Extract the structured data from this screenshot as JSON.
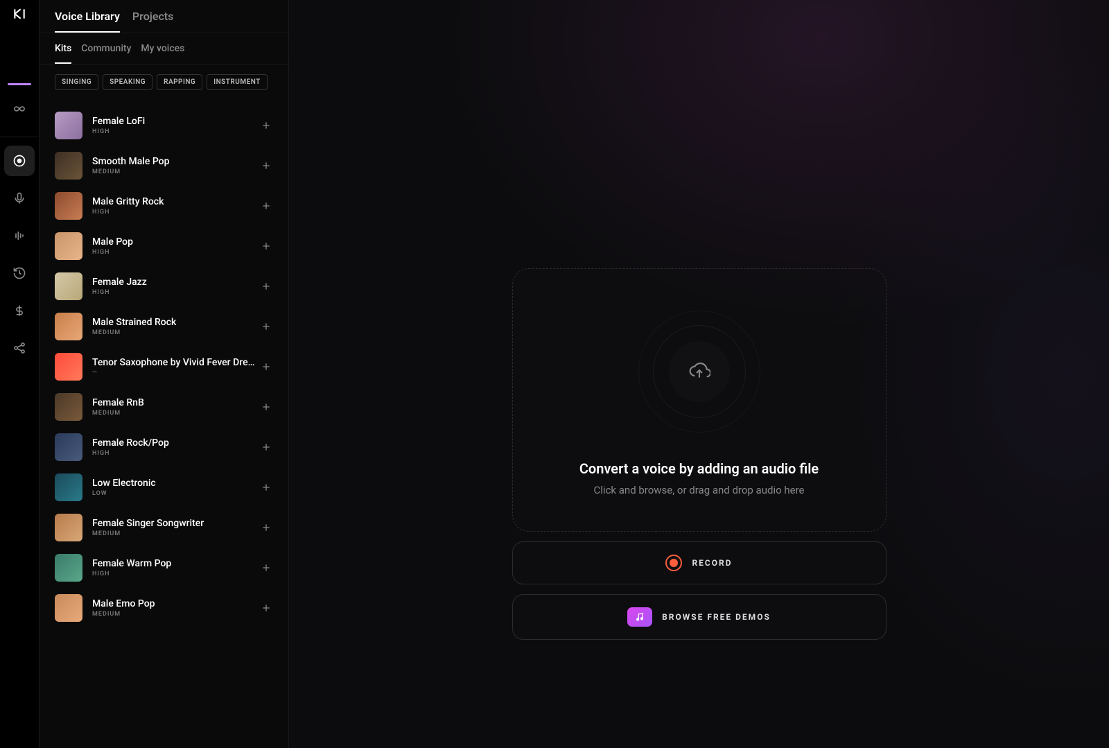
{
  "topNav": {
    "items": [
      {
        "label": "Voice Library",
        "active": true
      },
      {
        "label": "Projects",
        "active": false
      }
    ]
  },
  "subNav": {
    "items": [
      {
        "label": "Kits",
        "active": true
      },
      {
        "label": "Community",
        "active": false
      },
      {
        "label": "My voices",
        "active": false
      }
    ]
  },
  "filters": [
    {
      "label": "SINGING"
    },
    {
      "label": "SPEAKING"
    },
    {
      "label": "RAPPING"
    },
    {
      "label": "INSTRUMENT"
    }
  ],
  "voices": [
    {
      "name": "Female LoFi",
      "quality": "HIGH",
      "thumb": "g0"
    },
    {
      "name": "Smooth Male Pop",
      "quality": "MEDIUM",
      "thumb": "g1"
    },
    {
      "name": "Male Gritty Rock",
      "quality": "HIGH",
      "thumb": "g2"
    },
    {
      "name": "Male Pop",
      "quality": "HIGH",
      "thumb": "g3"
    },
    {
      "name": "Female Jazz",
      "quality": "HIGH",
      "thumb": "g4"
    },
    {
      "name": "Male Strained Rock",
      "quality": "MEDIUM",
      "thumb": "g5"
    },
    {
      "name": "Tenor Saxophone by Vivid Fever Dreams",
      "quality": "—",
      "thumb": "g6"
    },
    {
      "name": "Female RnB",
      "quality": "MEDIUM",
      "thumb": "g7"
    },
    {
      "name": "Female Rock/Pop",
      "quality": "HIGH",
      "thumb": "g8"
    },
    {
      "name": "Low Electronic",
      "quality": "LOW",
      "thumb": "g9"
    },
    {
      "name": "Female Singer Songwriter",
      "quality": "MEDIUM",
      "thumb": "g10"
    },
    {
      "name": "Female Warm Pop",
      "quality": "HIGH",
      "thumb": "g11"
    },
    {
      "name": "Male Emo Pop",
      "quality": "MEDIUM",
      "thumb": "g12"
    }
  ],
  "sidebarIcons": [
    {
      "name": "infinity-icon"
    },
    {
      "name": "disc-icon",
      "active": true
    },
    {
      "name": "microphone-icon"
    },
    {
      "name": "waveform-icon"
    },
    {
      "name": "history-icon"
    },
    {
      "name": "dollar-icon"
    },
    {
      "name": "share-icon"
    }
  ],
  "dropZone": {
    "title": "Convert a voice by adding an audio file",
    "subtitle": "Click and browse, or drag and drop audio here"
  },
  "actions": {
    "record": "RECORD",
    "browse": "BROWSE FREE DEMOS"
  }
}
